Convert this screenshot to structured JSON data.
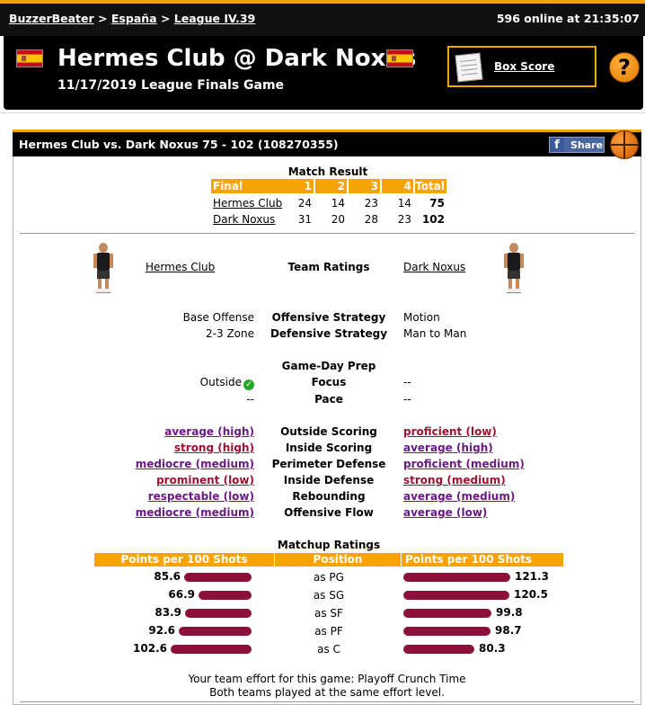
{
  "nav": {
    "breadcrumb": [
      "BuzzerBeater",
      "España",
      "League IV.39"
    ],
    "sep": ">",
    "online": "596 online at 21:35:07"
  },
  "header": {
    "title": "Hermes Club @ Dark Noxus",
    "subtitle": "11/17/2019 League Finals Game",
    "box_score": "Box Score",
    "help": "?"
  },
  "panel": {
    "title": "Hermes Club vs. Dark Noxus 75 - 102 (108270355)",
    "share": "Share",
    "share_icon": "f"
  },
  "match_result": {
    "title": "Match Result",
    "headers": [
      "Final",
      "1",
      "2",
      "3",
      "4",
      "Total"
    ],
    "rows": [
      {
        "team": "Hermes Club",
        "q": [
          "24",
          "14",
          "23",
          "14"
        ],
        "total": "75"
      },
      {
        "team": "Dark Noxus",
        "q": [
          "31",
          "20",
          "28",
          "23"
        ],
        "total": "102"
      }
    ]
  },
  "ratings": {
    "home": "Hermes Club",
    "away": "Dark Noxus",
    "title": "Team Ratings",
    "off_label": "Offensive Strategy",
    "def_label": "Defensive Strategy",
    "home_off": "Base Offense",
    "home_def": "2-3 Zone",
    "away_off": "Motion",
    "away_def": "Man to Man",
    "prep_title": "Game-Day Prep",
    "focus_label": "Focus",
    "pace_label": "Pace",
    "home_focus": "Outside",
    "home_pace": "--",
    "away_focus": "--",
    "away_pace": "--",
    "check": "✓",
    "items": [
      {
        "label": "Outside Scoring",
        "home": "average (high)",
        "away": "proficient (low)"
      },
      {
        "label": "Inside Scoring",
        "home": "strong (high)",
        "away": "average (high)"
      },
      {
        "label": "Perimeter Defense",
        "home": "mediocre (medium)",
        "away": "proficient (medium)"
      },
      {
        "label": "Inside Defense",
        "home": "prominent (low)",
        "away": "strong (medium)"
      },
      {
        "label": "Rebounding",
        "home": "respectable (low)",
        "away": "average (medium)"
      },
      {
        "label": "Offensive Flow",
        "home": "mediocre (medium)",
        "away": "average (low)"
      }
    ]
  },
  "matchup": {
    "title": "Matchup Ratings",
    "col_home": "Points per 100 Shots",
    "col_pos": "Position",
    "col_away": "Points per 100 Shots",
    "rows": [
      {
        "pos": "as PG",
        "home": "85.6",
        "away": "121.3"
      },
      {
        "pos": "as SG",
        "home": "66.9",
        "away": "120.5"
      },
      {
        "pos": "as SF",
        "home": "83.9",
        "away": "99.8"
      },
      {
        "pos": "as PF",
        "home": "92.6",
        "away": "98.7"
      },
      {
        "pos": "as C",
        "home": "102.6",
        "away": "80.3"
      }
    ]
  },
  "effort": {
    "line1": "Your team effort for this game: Playoff Crunch Time",
    "line2": "Both teams played at the same effort level."
  }
}
